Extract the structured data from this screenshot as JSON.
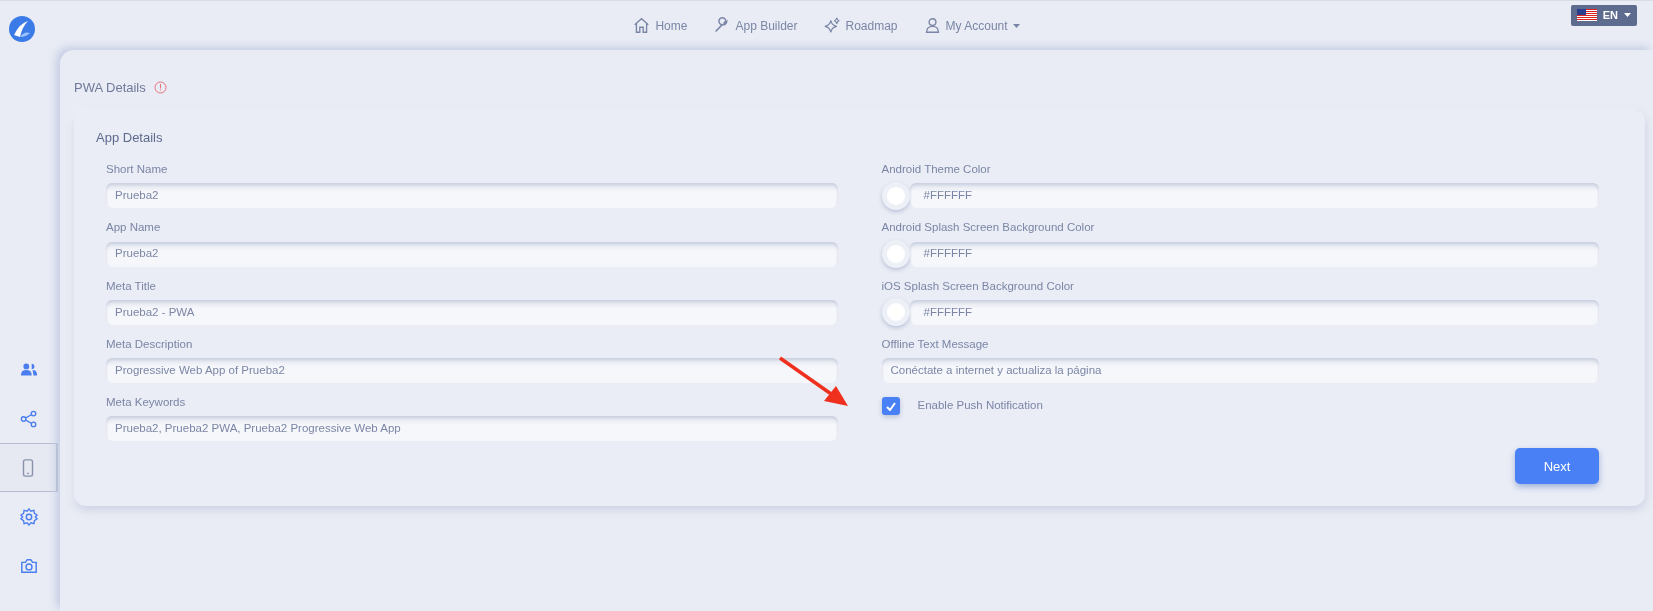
{
  "nav": [
    {
      "label": "Home",
      "dropdown": false
    },
    {
      "label": "App Builder",
      "dropdown": false
    },
    {
      "label": "Roadmap",
      "dropdown": false
    },
    {
      "label": "My Account",
      "dropdown": true
    }
  ],
  "language": {
    "label": "EN"
  },
  "sidebar": {
    "items": [
      {
        "selected": false
      },
      {
        "selected": false
      },
      {
        "selected": true
      },
      {
        "selected": false
      },
      {
        "selected": false
      }
    ]
  },
  "page_title": "PWA Details",
  "card": {
    "title": "App Details",
    "left_fields": [
      {
        "kind": "text",
        "label": "Short Name",
        "value": "Prueba2"
      },
      {
        "kind": "text",
        "label": "App Name",
        "value": "Prueba2"
      },
      {
        "kind": "text",
        "label": "Meta Title",
        "value": "Prueba2 - PWA"
      },
      {
        "kind": "text",
        "label": "Meta Description",
        "value": "Progressive Web App of Prueba2"
      },
      {
        "kind": "text",
        "label": "Meta Keywords",
        "value": "Prueba2, Prueba2 PWA, Prueba2 Progressive Web App"
      }
    ],
    "right_fields": [
      {
        "kind": "color",
        "label": "Android Theme Color",
        "value": "#FFFFFF",
        "color": "#ffffff"
      },
      {
        "kind": "color",
        "label": "Android Splash Screen Background Color",
        "value": "#FFFFFF",
        "color": "#ffffff"
      },
      {
        "kind": "color",
        "label": "iOS Splash Screen Background Color",
        "value": "#FFFFFF",
        "color": "#ffffff"
      },
      {
        "kind": "text",
        "label": "Offline Text Message",
        "value": "Conéctate a internet y actualiza la página"
      },
      {
        "kind": "checkbox",
        "label": "Enable Push Notification",
        "checked": true
      }
    ],
    "button": "Next"
  }
}
